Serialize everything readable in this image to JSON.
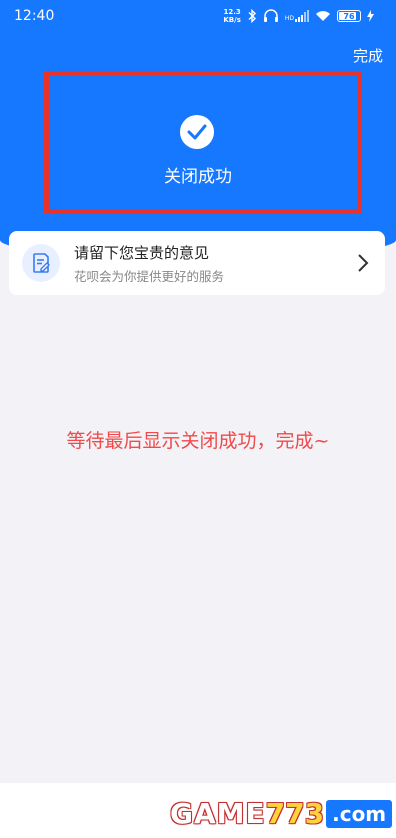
{
  "status_bar": {
    "time": "12:40",
    "net_speed_value": "12.3",
    "net_speed_unit": "KB/s",
    "hd_label": "HD",
    "battery": "76"
  },
  "header": {
    "done_label": "完成",
    "success_title": "关闭成功"
  },
  "feedback": {
    "title": "请留下您宝贵的意见",
    "subtitle": "花呗会为你提供更好的服务"
  },
  "caption": "等待最后显示关闭成功，完成~",
  "watermark": {
    "game": "GAME",
    "number": "773",
    "domain": ".com"
  },
  "colors": {
    "primary_blue": "#1677ff",
    "highlight_red": "#e8322a",
    "caption_red": "#f04a4a",
    "background": "#f3f3f7"
  },
  "icons": {
    "success": "check-circle-icon",
    "feedback": "document-edit-icon",
    "chevron": "chevron-right-icon"
  }
}
